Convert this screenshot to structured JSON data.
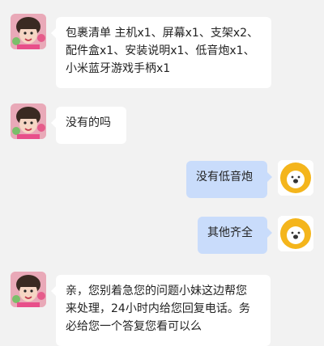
{
  "colors": {
    "background": "#f2f2f2",
    "incoming_bubble": "#ffffff",
    "outgoing_bubble": "#c9dcfb",
    "lion_yellow": "#f4b51c"
  },
  "messages": [
    {
      "side": "in",
      "avatar": "girl-avatar",
      "text": "包裹清单 主机x1、屏幕x1、支架x2、\n配件盒x1、安装说明x1、低音炮x1、\n小米蓝牙游戏手柄x1"
    },
    {
      "side": "in",
      "avatar": "girl-avatar",
      "text": "没有的吗"
    },
    {
      "side": "out",
      "avatar": "lion-avatar",
      "text": "没有低音炮"
    },
    {
      "side": "out",
      "avatar": "lion-avatar",
      "text": "其他齐全"
    },
    {
      "side": "in",
      "avatar": "girl-avatar",
      "text": "亲，您别着急您的问题小妹这边帮您\n来处理，24小时内给您回复电话。务\n必给您一个答复您看可以么"
    }
  ]
}
